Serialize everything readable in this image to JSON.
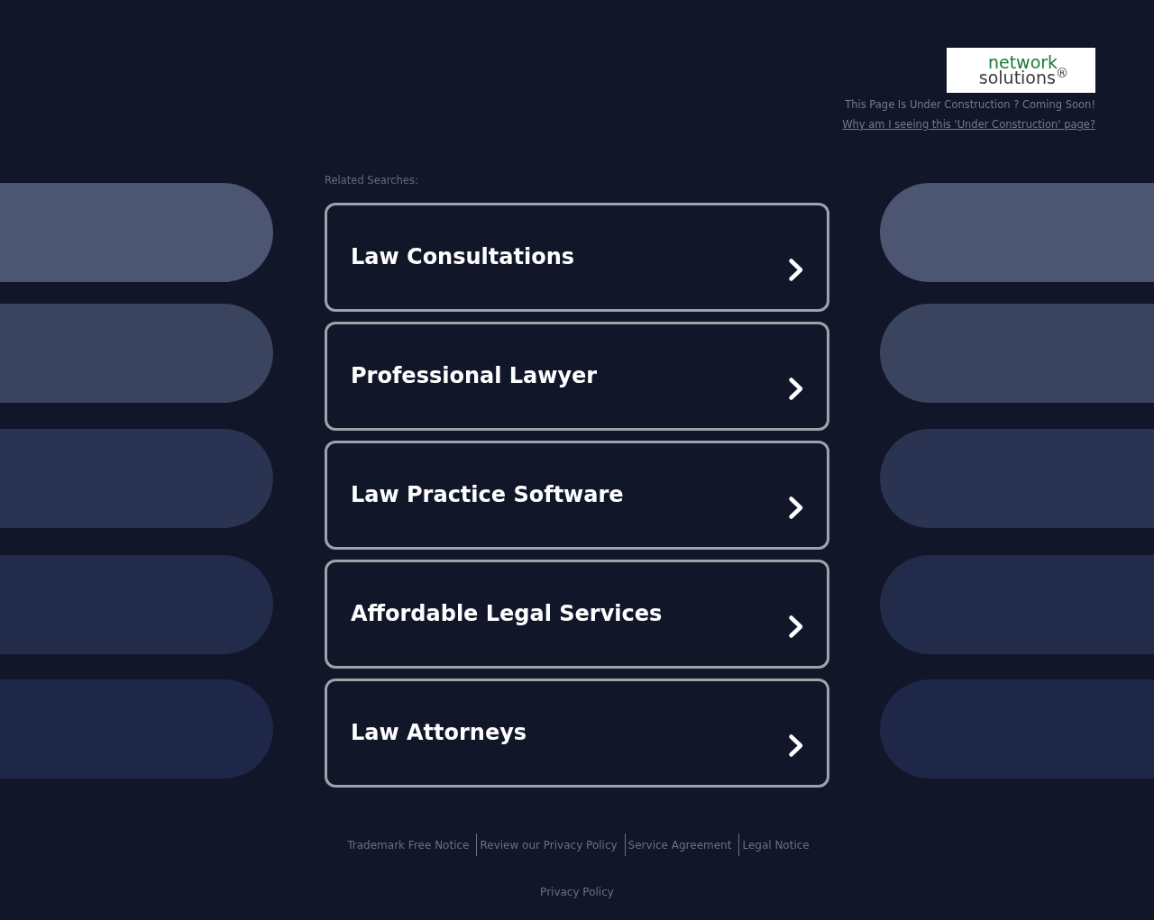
{
  "header": {
    "logo": {
      "line_1": "network",
      "line_2": "solutions$^{®}$"
    },
    "notice": "This Page Is Under Construction ? Coming Soon!",
    "link": "Why am I seeing this 'Under Construction' page?"
  },
  "related": {
    "heading": "Related Searches:",
    "items": [
      {
        "label": "Law Consultations"
      },
      {
        "label": "Professional Lawyer"
      },
      {
        "label": "Law Practice Software"
      },
      {
        "label": "Affordable Legal Services"
      },
      {
        "label": "Law Attorneys"
      }
    ]
  },
  "footer": {
    "links": [
      "Trademark Free Notice",
      "Review our Privacy Policy",
      "Service Agreement",
      "Legal Notice"
    ],
    "privacy": "Privacy Policy"
  }
}
